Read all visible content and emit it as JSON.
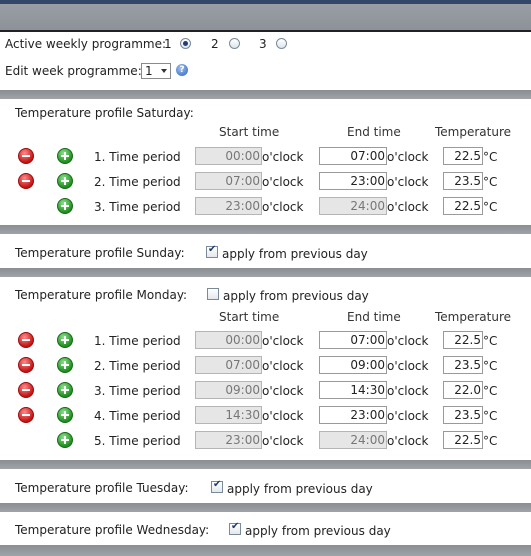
{
  "top": {
    "active_label": "Active weekly programme:",
    "programme_options": [
      {
        "label": "1",
        "selected": true
      },
      {
        "label": "2",
        "selected": false
      },
      {
        "label": "3",
        "selected": false
      }
    ],
    "edit_label": "Edit week programme:",
    "edit_value": "1",
    "help_icon": "help-icon"
  },
  "cols": {
    "start": "Start time",
    "end": "End time",
    "temp": "Temperature"
  },
  "unit_clock": "o'clock",
  "unit_temp": "°C",
  "saturday": {
    "title": "Temperature profile Saturday:",
    "rows": [
      {
        "label": "1. Time period",
        "start": "00:00",
        "end": "07:00",
        "temp": "22.5"
      },
      {
        "label": "2. Time period",
        "start": "07:00",
        "end": "23:00",
        "temp": "23.5"
      },
      {
        "label": "3. Time period",
        "start": "23:00",
        "end": "24:00",
        "temp": "22.5"
      }
    ]
  },
  "sunday": {
    "title": "Temperature profile Sunday:",
    "apply": "apply from previous day",
    "checked": true
  },
  "monday": {
    "title": "Temperature profile Monday:",
    "apply": "apply from previous day",
    "checked": false,
    "rows": [
      {
        "label": "1. Time period",
        "start": "00:00",
        "end": "07:00",
        "temp": "22.5"
      },
      {
        "label": "2. Time period",
        "start": "07:00",
        "end": "09:00",
        "temp": "23.5"
      },
      {
        "label": "3. Time period",
        "start": "09:00",
        "end": "14:30",
        "temp": "22.0"
      },
      {
        "label": "4. Time period",
        "start": "14:30",
        "end": "23:00",
        "temp": "23.5"
      },
      {
        "label": "5. Time period",
        "start": "23:00",
        "end": "24:00",
        "temp": "22.5"
      }
    ]
  },
  "tuesday": {
    "title": "Temperature profile Tuesday:",
    "apply": "apply from previous day",
    "checked": true
  },
  "wednesday": {
    "title": "Temperature profile Wednesday:",
    "apply": "apply from previous day",
    "checked": true
  }
}
